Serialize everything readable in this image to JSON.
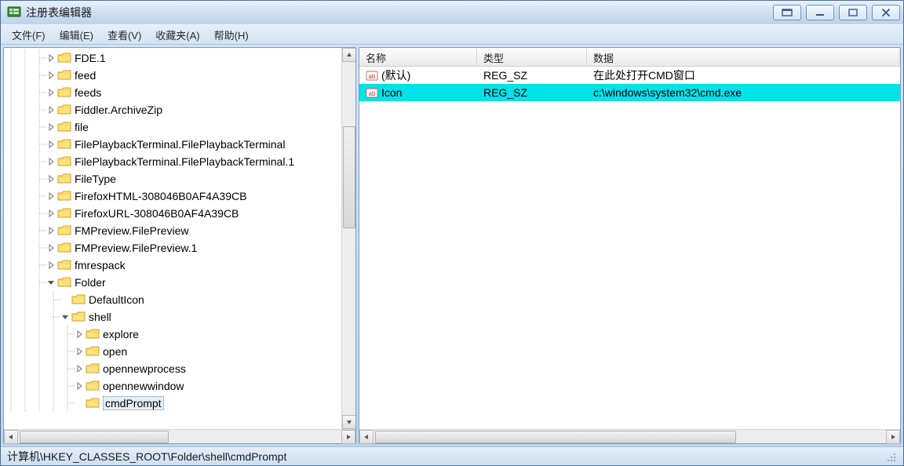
{
  "app": {
    "title": "注册表编辑器"
  },
  "menu": {
    "file": "文件(F)",
    "edit": "编辑(E)",
    "view": "查看(V)",
    "fav": "收藏夹(A)",
    "help": "帮助(H)"
  },
  "tree": [
    {
      "depth": 3,
      "exp": "closed",
      "label": "FDE.1"
    },
    {
      "depth": 3,
      "exp": "closed",
      "label": "feed"
    },
    {
      "depth": 3,
      "exp": "closed",
      "label": "feeds"
    },
    {
      "depth": 3,
      "exp": "closed",
      "label": "Fiddler.ArchiveZip"
    },
    {
      "depth": 3,
      "exp": "closed",
      "label": "file"
    },
    {
      "depth": 3,
      "exp": "closed",
      "label": "FilePlaybackTerminal.FilePlaybackTerminal"
    },
    {
      "depth": 3,
      "exp": "closed",
      "label": "FilePlaybackTerminal.FilePlaybackTerminal.1"
    },
    {
      "depth": 3,
      "exp": "closed",
      "label": "FileType"
    },
    {
      "depth": 3,
      "exp": "closed",
      "label": "FirefoxHTML-308046B0AF4A39CB"
    },
    {
      "depth": 3,
      "exp": "closed",
      "label": "FirefoxURL-308046B0AF4A39CB"
    },
    {
      "depth": 3,
      "exp": "closed",
      "label": "FMPreview.FilePreview"
    },
    {
      "depth": 3,
      "exp": "closed",
      "label": "FMPreview.FilePreview.1"
    },
    {
      "depth": 3,
      "exp": "closed",
      "label": "fmrespack"
    },
    {
      "depth": 3,
      "exp": "open",
      "label": "Folder"
    },
    {
      "depth": 4,
      "exp": "none",
      "label": "DefaultIcon"
    },
    {
      "depth": 4,
      "exp": "open",
      "label": "shell"
    },
    {
      "depth": 5,
      "exp": "closed",
      "label": "explore"
    },
    {
      "depth": 5,
      "exp": "closed",
      "label": "open"
    },
    {
      "depth": 5,
      "exp": "closed",
      "label": "opennewprocess"
    },
    {
      "depth": 5,
      "exp": "closed",
      "label": "opennewwindow"
    },
    {
      "depth": 5,
      "exp": "none",
      "label": "cmdPrompt",
      "selected": true
    }
  ],
  "list": {
    "columns": {
      "name": "名称",
      "type": "类型",
      "data": "数据"
    },
    "rows": [
      {
        "name": "(默认)",
        "type": "REG_SZ",
        "data": "在此处打开CMD窗口"
      },
      {
        "name": "Icon",
        "type": "REG_SZ",
        "data": "c:\\windows\\system32\\cmd.exe",
        "selected": true
      }
    ]
  },
  "status": {
    "path": "计算机\\HKEY_CLASSES_ROOT\\Folder\\shell\\cmdPrompt"
  }
}
